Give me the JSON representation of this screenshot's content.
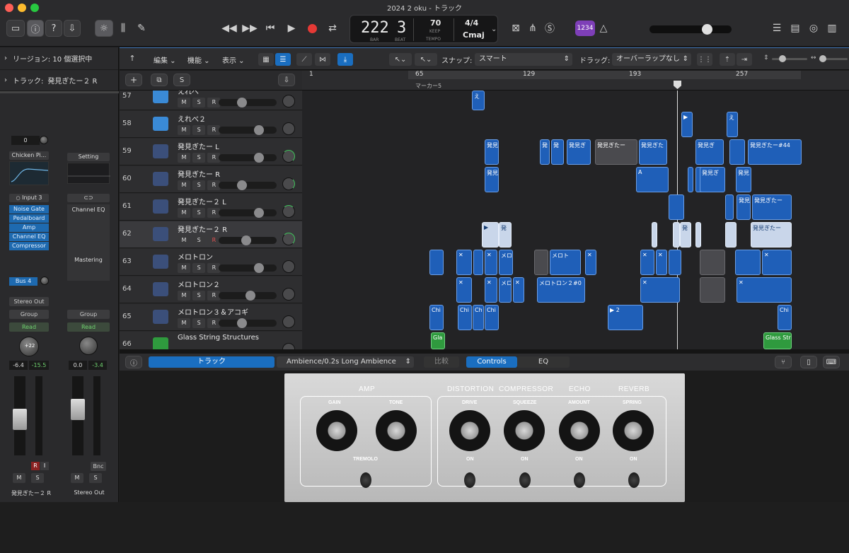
{
  "window": {
    "title": "2024 2 oku - トラック"
  },
  "lcd": {
    "bar": "222",
    "beat": "3",
    "bar_label": "BAR",
    "beat_label": "BEAT",
    "tempo": "70",
    "keep": "KEEP",
    "tempo_label": "TEMPO",
    "sig": "4/4",
    "key": "Cmaj"
  },
  "topbar": {
    "count_in": "1234"
  },
  "inspector": {
    "region_header": "リージョン: 10 個選択中",
    "track_header": "トラック:",
    "track_name": "発見ぎたー２ R",
    "strip1": {
      "value": "0",
      "patch": "Chicken Pi...",
      "input": "Input 3",
      "plugins": [
        "Noise Gate",
        "Pedalboard",
        "Amp",
        "Channel EQ",
        "Compressor"
      ],
      "send": "Bus 4",
      "output": "Stereo Out",
      "group": "Group",
      "automation": "Read",
      "pan": "+22",
      "vol1": "-6.4",
      "vol2": "-15.5",
      "name": "発見ぎたー２ R",
      "m": "M",
      "s": "S",
      "r": "R",
      "i": "I"
    },
    "strip2": {
      "setting": "Setting",
      "eq": "Channel EQ",
      "mastering": "Mastering",
      "group": "Group",
      "automation": "Read",
      "vol1": "0.0",
      "vol2": "-3.4",
      "bnc": "Bnc",
      "name": "Stereo Out",
      "m": "M",
      "s": "S"
    }
  },
  "toolbar": {
    "edit": "編集",
    "function": "機能",
    "view": "表示",
    "snap_label": "スナップ:",
    "snap_value": "スマート",
    "drag_label": "ドラッグ:",
    "drag_value": "オーバーラップなし"
  },
  "trackheader": {
    "add": "+",
    "s": "S"
  },
  "ruler": {
    "marks": [
      "1",
      "65",
      "129",
      "193",
      "257"
    ],
    "marker": "マーカー5"
  },
  "tracks": [
    {
      "num": "57",
      "name": "えれべ",
      "color": "#3a8ad6"
    },
    {
      "num": "58",
      "name": "えれべ２",
      "color": "#3a8ad6"
    },
    {
      "num": "59",
      "name": "発見ぎたー L",
      "color": "#4c5ea8"
    },
    {
      "num": "60",
      "name": "発見ぎたー R",
      "color": "#4c5ea8"
    },
    {
      "num": "61",
      "name": "発見ぎたー２ L",
      "color": "#4c5ea8"
    },
    {
      "num": "62",
      "name": "発見ぎたー２ R",
      "color": "#4c5ea8"
    },
    {
      "num": "63",
      "name": "メロトロン",
      "color": "#4c5ea8"
    },
    {
      "num": "64",
      "name": "メロトロン２",
      "color": "#4c5ea8"
    },
    {
      "num": "65",
      "name": "メロトロン３＆アコギ",
      "color": "#4c5ea8"
    },
    {
      "num": "66",
      "name": "Glass String Structures",
      "color": "#2f9a3e"
    }
  ],
  "ms": {
    "m": "M",
    "s": "S",
    "r": "R"
  },
  "regions": {
    "r59a": "発見",
    "r59b": "発",
    "r59c": "発",
    "r59d": "発見ぎ",
    "r59e": "発見ぎたー",
    "r59f": "発見ぎた",
    "r59g": "発見ぎ",
    "r59h": "発見ぎたー#44",
    "r60a": "発見",
    "r60b": "A",
    "r60c": "発見ぎ",
    "r60d": "発見",
    "r61a": "発見",
    "r61b": "発見ぎたー",
    "r62a": "発",
    "r62b": "発",
    "r62c": "発見ぎたー",
    "r63a": "メロ",
    "r63b": "メロト",
    "r64a": "メロ",
    "r64b": "メロトロン２#0",
    "r65a": "Chi",
    "r65b": "Chi",
    "r65c": "Ch",
    "r65d": "Chi",
    "r65e": "2",
    "r65f": "Chi",
    "r66a": "Gla",
    "r66b": "Glass Str",
    "r57a": "え",
    "r58a": "え"
  },
  "editor": {
    "track_tab": "トラック",
    "preset": "Ambience/0.2s Long Ambience",
    "compare": "比較",
    "controls": "Controls",
    "eq": "EQ"
  },
  "amp": {
    "amp": "AMP",
    "gain": "GAIN",
    "tone": "TONE",
    "tremolo": "TREMOLO",
    "distortion": "DISTORTION",
    "compressor": "COMPRESSOR",
    "echo": "ECHO",
    "reverb": "REVERB",
    "drive": "DRIVE",
    "squeeze": "SQUEEZE",
    "amount": "AMOUNT",
    "spring": "SPRING",
    "on": "ON"
  }
}
